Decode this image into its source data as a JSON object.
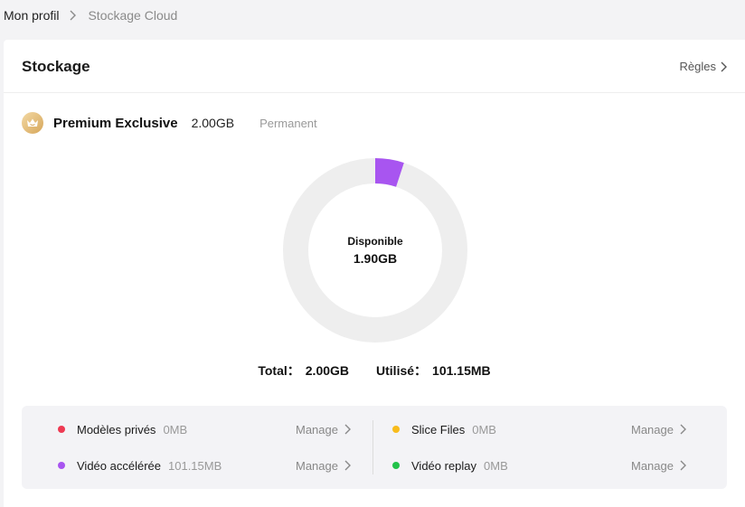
{
  "breadcrumb": {
    "root": "Mon profil",
    "current": "Stockage Cloud"
  },
  "header": {
    "title": "Stockage",
    "rules_label": "Règles"
  },
  "plan": {
    "name": "Premium Exclusive",
    "size": "2.00GB",
    "type": "Permanent"
  },
  "donut": {
    "label": "Disponible",
    "value": "1.90GB",
    "used_fraction": 0.0505,
    "colors": {
      "track": "#eeeeee",
      "used": "#a855f0"
    }
  },
  "totals": {
    "total_label": "Total：",
    "total_value": "2.00GB",
    "used_label": "Utilisé：",
    "used_value": "101.15MB"
  },
  "categories": [
    {
      "name": "Modèles privés",
      "size": "0MB",
      "color": "#ee3a52",
      "manage_label": "Manage"
    },
    {
      "name": "Vidéo accélérée",
      "size": "101.15MB",
      "color": "#a855f0",
      "manage_label": "Manage"
    },
    {
      "name": "Slice Files",
      "size": "0MB",
      "color": "#f8bc1c",
      "manage_label": "Manage"
    },
    {
      "name": "Vidéo replay",
      "size": "0MB",
      "color": "#22c24a",
      "manage_label": "Manage"
    }
  ],
  "icons": {
    "breadcrumb_separator": "chevron-right-icon",
    "rules": "chevron-right-icon",
    "plan_badge": "crown-icon",
    "manage": "chevron-right-icon"
  }
}
